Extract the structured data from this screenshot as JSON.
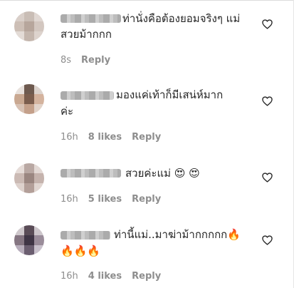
{
  "comments": [
    {
      "text_line1": "ท่านั่งคือต้องยอมจริงๆ แม่",
      "text_line2": "สวยม้ากกก",
      "time": "8s",
      "likes": "",
      "reply": "Reply"
    },
    {
      "text_line1": "มองแค่เท้าก็มีเสน่ห์มาก",
      "text_line2": "ค่ะ",
      "time": "16h",
      "likes": "8 likes",
      "reply": "Reply"
    },
    {
      "text_line1": "สวยค่ะแม่ 😍 😍",
      "text_line2": "",
      "time": "16h",
      "likes": "5 likes",
      "reply": "Reply"
    },
    {
      "text_line1": "ท่านี้แม่..มาฆ่าม้ากกกกก🔥",
      "text_line2": "🔥🔥🔥",
      "time": "16h",
      "likes": "4 likes",
      "reply": "Reply"
    }
  ],
  "icons": {
    "like": "heart-outline-icon"
  },
  "colors": {
    "meta": "#8e8e8e",
    "text": "#262626"
  }
}
